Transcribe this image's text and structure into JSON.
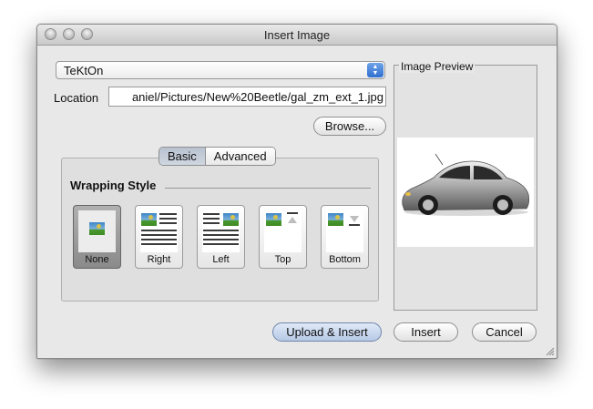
{
  "window": {
    "title": "Insert Image"
  },
  "source_select": {
    "value": "TeKtOn"
  },
  "location": {
    "label": "Location",
    "value": "aniel/Pictures/New%20Beetle/gal_zm_ext_1.jpg"
  },
  "browse_label": "Browse...",
  "tabs": [
    {
      "label": "Basic",
      "active": true
    },
    {
      "label": "Advanced",
      "active": false
    }
  ],
  "wrapping": {
    "title": "Wrapping Style",
    "options": [
      {
        "label": "None",
        "selected": true
      },
      {
        "label": "Right",
        "selected": false
      },
      {
        "label": "Left",
        "selected": false
      },
      {
        "label": "Top",
        "selected": false
      },
      {
        "label": "Bottom",
        "selected": false
      }
    ]
  },
  "preview": {
    "label": "Image Preview",
    "image": "silver-beetle-car"
  },
  "buttons": {
    "upload_insert": "Upload & Insert",
    "insert": "Insert",
    "cancel": "Cancel"
  },
  "colors": {
    "selected_style": "#8a8a8a",
    "default_button": "#b7c9e6",
    "picture_sky": "#3d86c6",
    "picture_grass": "#4a9a2e"
  }
}
